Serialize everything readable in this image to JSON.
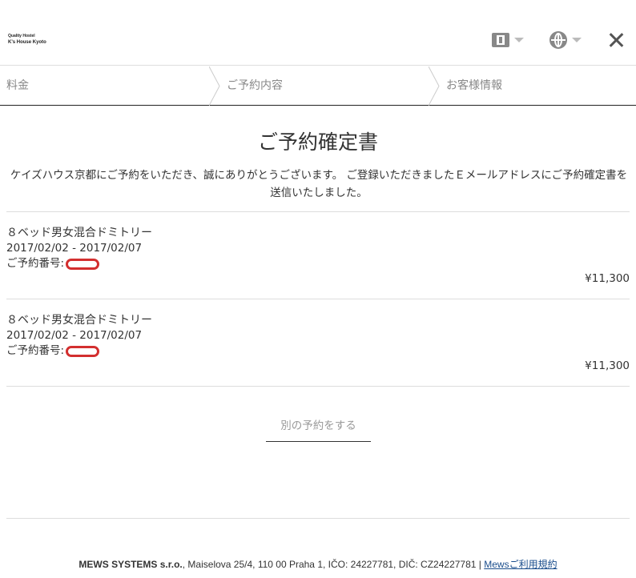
{
  "header": {
    "logo_line1": "Quality Hostel",
    "logo_line2": "K's House Kyoto",
    "currency_icon": "currency-icon",
    "language_icon": "globe-icon",
    "close_icon": "close-icon"
  },
  "steps": [
    {
      "label": "料金"
    },
    {
      "label": "ご予約内容"
    },
    {
      "label": "お客様情報"
    }
  ],
  "title": "ご予約確定書",
  "message": "ケイズハウス京都にご予約をいただき、誠にありがとうございます。 ご登録いただきましたＥメールアドレスにご予約確定書を送信いたしました。",
  "reservations": [
    {
      "name": "８ベッド男女混合ドミトリー",
      "dates": "2017/02/02 - 2017/02/07",
      "number_label": "ご予約番号:",
      "price": "¥11,300"
    },
    {
      "name": "８ベッド男女混合ドミトリー",
      "dates": "2017/02/02 - 2017/02/07",
      "number_label": "ご予約番号:",
      "price": "¥11,300"
    }
  ],
  "another_reservation": "別の予約をする",
  "footer": {
    "company": "MEWS SYSTEMS s.r.o.",
    "address": ", Maiselova 25/4, 110 00 Praha 1, IČO: 24227781, DIČ: CZ24227781 | ",
    "terms_link": "Mewsご利用規約"
  },
  "colors": {
    "redaction": "#d32f2f",
    "link": "#1a4d8c"
  }
}
